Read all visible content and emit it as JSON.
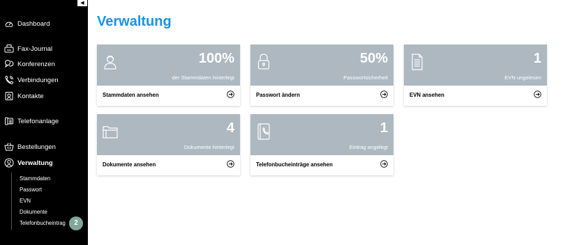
{
  "sidebar": {
    "collapse_glyph": "◀",
    "items": [
      {
        "label": "Dashboard",
        "icon": "dashboard-gauge-icon"
      },
      {
        "label": "Fax-Journal",
        "icon": "fax-icon"
      },
      {
        "label": "Konferenzen",
        "icon": "conference-chat-icon"
      },
      {
        "label": "Verbindungen",
        "icon": "phone-calls-icon"
      },
      {
        "label": "Kontakte",
        "icon": "contacts-icon"
      },
      {
        "label": "Telefonanlage",
        "icon": "phone-system-icon"
      },
      {
        "label": "Bestellungen",
        "icon": "shopping-basket-icon"
      },
      {
        "label": "Verwaltung",
        "icon": "admin-user-icon",
        "active": true
      }
    ],
    "subitems": [
      "Stammdaten",
      "Passwort",
      "EVN",
      "Dokumente",
      "Telefonbucheintrag"
    ],
    "badge": "2"
  },
  "main": {
    "title": "Verwaltung",
    "cards": [
      {
        "value": "100%",
        "desc": "der Stammdaten hinterlegt",
        "link": "Stammdaten ansehen",
        "icon": "user-profile-icon"
      },
      {
        "value": "50%",
        "desc": "Passwortsicherheit",
        "link": "Passwort ändern",
        "icon": "padlock-icon"
      },
      {
        "value": "1",
        "desc": "EVN ungelesen",
        "link": "EVN ansehen",
        "icon": "document-list-icon"
      },
      {
        "value": "4",
        "desc": "Dokumente hinterlegt",
        "link": "Dokumente ansehen",
        "icon": "folder-icon"
      },
      {
        "value": "1",
        "desc": "Eintrag angelegt",
        "link": "Telefonbucheinträge ansehen",
        "icon": "phonebook-icon"
      }
    ]
  },
  "colors": {
    "accent": "#1a93e8",
    "card_header": "#adb8c0",
    "sidebar_bg": "#000000",
    "badge": "#7fa89a"
  }
}
